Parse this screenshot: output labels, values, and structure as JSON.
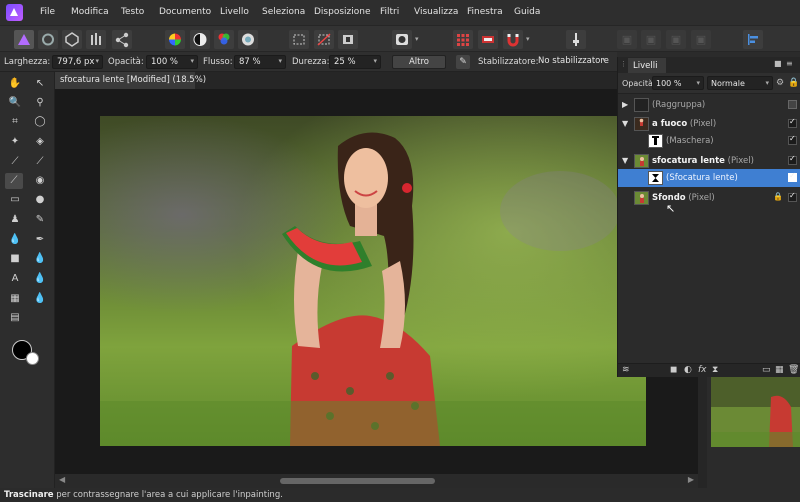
{
  "menu": [
    "File",
    "Modifica",
    "Testo",
    "Documento",
    "Livello",
    "Seleziona",
    "Disposizione",
    "Filtri",
    "Visualizza",
    "Finestra",
    "Guida"
  ],
  "context": {
    "width_label": "Larghezza:",
    "width_value": "797,6 px",
    "opacity_label": "Opacità:",
    "opacity_value": "100 %",
    "flow_label": "Flusso:",
    "flow_value": "87 %",
    "hardness_label": "Durezza:",
    "hardness_value": "25 %",
    "more_button": "Altro",
    "stabilizer_label": "Stabilizzatore:",
    "stabilizer_value": "No stabilizzatore"
  },
  "document_tab": "sfocatura lente [Modified] (18.5%)",
  "layers_panel": {
    "tab": "Livelli",
    "opacity_label": "Opacità:",
    "opacity_value": "100 %",
    "blend_mode": "Normale",
    "rows": [
      {
        "name": "",
        "type": "(Raggruppa)"
      },
      {
        "name": "a fuoco",
        "type": "(Pixel)"
      },
      {
        "name": "",
        "type": "(Maschera)"
      },
      {
        "name": "sfocatura lente",
        "type": "(Pixel)"
      },
      {
        "name": "",
        "type": "(Sfocatura lente)"
      },
      {
        "name": "Sfondo",
        "type": "(Pixel)"
      }
    ]
  },
  "status": {
    "tool": "Trascinare",
    "hint": " per contrassegnare l'area a cui applicare l'inpainting."
  },
  "colors": {
    "accent": "#3f7fd2",
    "app_bg": "#2b2b2b"
  }
}
